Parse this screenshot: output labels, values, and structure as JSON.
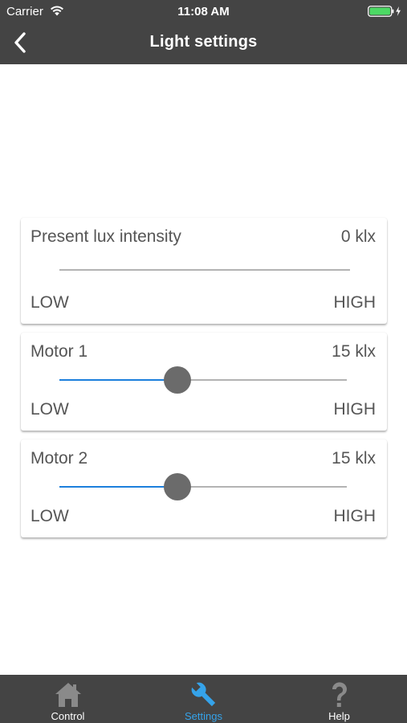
{
  "status_bar": {
    "carrier": "Carrier",
    "time": "11:08 AM"
  },
  "nav": {
    "title": "Light settings"
  },
  "cards": [
    {
      "label": "Present lux intensity",
      "value": "0 klx",
      "low": "LOW",
      "high": "HIGH",
      "has_thumb": false
    },
    {
      "label": "Motor 1",
      "value": "15 klx",
      "low": "LOW",
      "high": "HIGH",
      "slider_level": 0.41
    },
    {
      "label": "Motor 2",
      "value": "15 klx",
      "low": "LOW",
      "high": "HIGH",
      "slider_level": 0.41
    }
  ],
  "tabs": [
    {
      "label": "Control",
      "icon": "home-icon",
      "active": false
    },
    {
      "label": "Settings",
      "icon": "wrench-icon",
      "active": true
    },
    {
      "label": "Help",
      "icon": "question-icon",
      "active": false
    }
  ],
  "colors": {
    "bar_background": "#444444",
    "accent": "#35a3ea",
    "slider_fill": "#1c7fdc",
    "thumb": "#6b6b6b",
    "battery": "#4cd964"
  }
}
